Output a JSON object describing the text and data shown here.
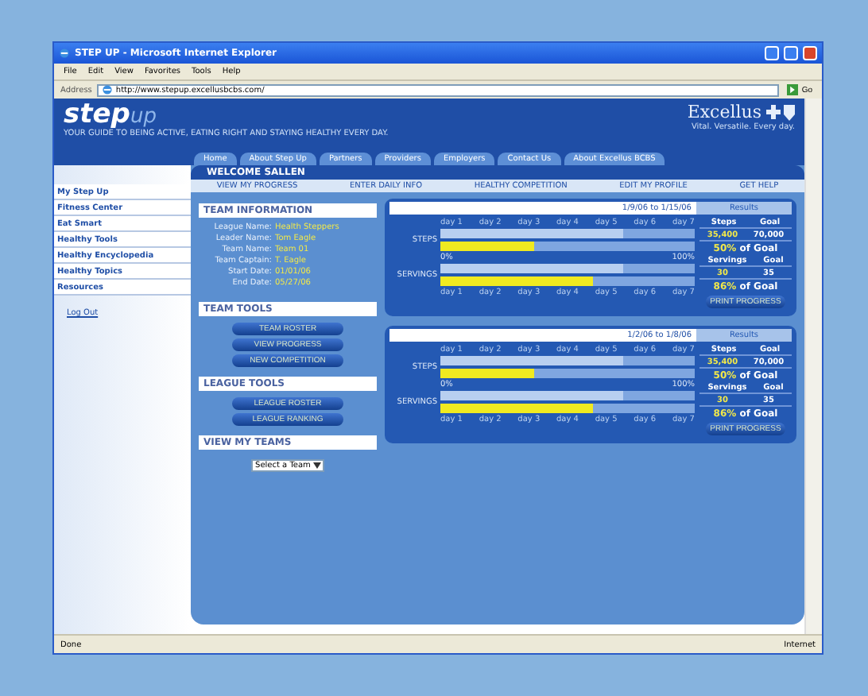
{
  "window": {
    "title": "STEP UP - Microsoft Internet Explorer"
  },
  "menu": [
    "File",
    "Edit",
    "View",
    "Favorites",
    "Tools",
    "Help"
  ],
  "address": {
    "label": "Address",
    "value": "http://www.stepup.excellusbcbs.com/",
    "go": "Go"
  },
  "header": {
    "logo": "step",
    "logo_raised": "up",
    "tagline": "YOUR GUIDE TO BEING ACTIVE, EATING RIGHT AND STAYING HEALTHY EVERY DAY.",
    "brand": "Excellus",
    "brand_tagline": "Vital. Versatile. Every day."
  },
  "nav_tabs": [
    "Home",
    "About Step Up",
    "Partners",
    "Providers",
    "Employers",
    "Contact Us",
    "About Excellus BCBS"
  ],
  "sidebar": {
    "items": [
      "My Step Up",
      "Fitness Center",
      "Eat Smart",
      "Healthy Tools",
      "Healthy Encyclopedia",
      "Healthy Topics",
      "Resources"
    ],
    "logout": "Log Out"
  },
  "welcome": "WELCOME SALLEN",
  "subnav": [
    "VIEW MY PROGRESS",
    "ENTER DAILY INFO",
    "HEALTHY COMPETITION",
    "EDIT MY PROFILE",
    "GET HELP"
  ],
  "team_info": {
    "title": "TEAM INFORMATION",
    "fields": [
      {
        "label": "League Name:",
        "value": "Health Steppers"
      },
      {
        "label": "Leader Name:",
        "value": "Tom Eagle"
      },
      {
        "label": "Team Name:",
        "value": "Team 01"
      },
      {
        "label": "Team Captain:",
        "value": "T. Eagle"
      },
      {
        "label": "Start Date:",
        "value": "01/01/06"
      },
      {
        "label": "End Date:",
        "value": "05/27/06"
      }
    ]
  },
  "team_tools": {
    "title": "TEAM TOOLS",
    "buttons": [
      "TEAM ROSTER",
      "VIEW PROGRESS",
      "NEW COMPETITION"
    ]
  },
  "league_tools": {
    "title": "LEAGUE TOOLS",
    "buttons": [
      "LEAGUE ROSTER",
      "LEAGUE RANKING"
    ]
  },
  "my_teams": {
    "title": "VIEW MY TEAMS",
    "select": "Select a Team"
  },
  "results": [
    {
      "range": "1/9/06 to 1/15/06",
      "tab": "Results",
      "days": [
        "day 1",
        "day 2",
        "day 3",
        "day 4",
        "day 5",
        "day 6",
        "day 7"
      ],
      "days_bottom": [
        "day 1",
        "day 2",
        "day 3",
        "day 4",
        "day 5",
        "day 6",
        "day 7"
      ],
      "scale_min": "0%",
      "scale_max": "100%",
      "rows": [
        {
          "label": "STEPS",
          "meters": [
            {
              "level": 0.72
            },
            {
              "level": 0.37
            }
          ]
        },
        {
          "label": "SERVINGS",
          "meters": [
            {
              "level": 0.72
            },
            {
              "level": 0.6
            }
          ]
        }
      ],
      "stats": [
        {
          "head": "Steps",
          "goal_head": "Goal",
          "value": "35,400",
          "goal": "70,000",
          "percent": "50%",
          "of_goal": "of Goal"
        },
        {
          "head": "Servings",
          "goal_head": "Goal",
          "value": "30",
          "goal": "35",
          "percent": "86%",
          "of_goal": "of Goal"
        }
      ],
      "print": "PRINT PROGRESS"
    },
    {
      "range": "1/2/06 to 1/8/06",
      "tab": "Results",
      "days": [
        "day 1",
        "day 2",
        "day 3",
        "day 4",
        "day 5",
        "day 6",
        "day 7"
      ],
      "days_bottom": [
        "day 1",
        "day 2",
        "day 3",
        "day 4",
        "day 5",
        "day 6",
        "day 7"
      ],
      "scale_min": "0%",
      "scale_max": "100%",
      "rows": [
        {
          "label": "STEPS",
          "meters": [
            {
              "level": 0.72
            },
            {
              "level": 0.37
            }
          ]
        },
        {
          "label": "SERVINGS",
          "meters": [
            {
              "level": 0.72
            },
            {
              "level": 0.6
            }
          ]
        }
      ],
      "stats": [
        {
          "head": "Steps",
          "goal_head": "Goal",
          "value": "35,400",
          "goal": "70,000",
          "percent": "50%",
          "of_goal": "of Goal"
        },
        {
          "head": "Servings",
          "goal_head": "Goal",
          "value": "30",
          "goal": "35",
          "percent": "86%",
          "of_goal": "of Goal"
        }
      ],
      "print": "PRINT PROGRESS"
    }
  ],
  "status": {
    "text": "Done",
    "zone": "Internet"
  }
}
